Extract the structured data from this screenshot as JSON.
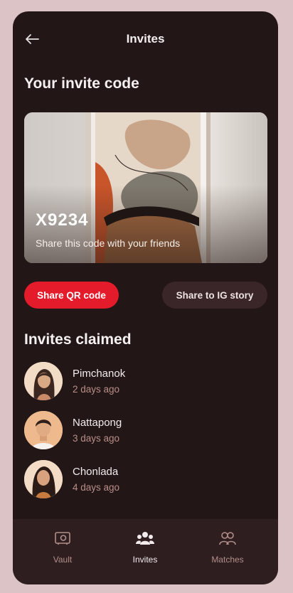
{
  "header": {
    "title": "Invites",
    "back_icon": "arrow-left-icon"
  },
  "invite_code": {
    "section_title": "Your invite code",
    "code": "X9234",
    "hint": "Share this code with your friends"
  },
  "actions": {
    "share_qr": "Share QR code",
    "share_ig": "Share to IG story"
  },
  "claimed": {
    "section_title": "Invites claimed",
    "items": [
      {
        "name": "Pimchanok",
        "time": "2 days ago"
      },
      {
        "name": "Nattapong",
        "time": "3 days ago"
      },
      {
        "name": "Chonlada",
        "time": "4 days ago"
      }
    ]
  },
  "nav": {
    "items": [
      {
        "label": "Vault",
        "icon": "vault-icon"
      },
      {
        "label": "Invites",
        "icon": "people-icon"
      },
      {
        "label": "Matches",
        "icon": "matches-icon"
      }
    ],
    "active": "Invites"
  },
  "colors": {
    "background": "#231617",
    "accent": "#e31b2a",
    "secondary_button": "#3a2628",
    "subtle_text": "#b98e88"
  }
}
